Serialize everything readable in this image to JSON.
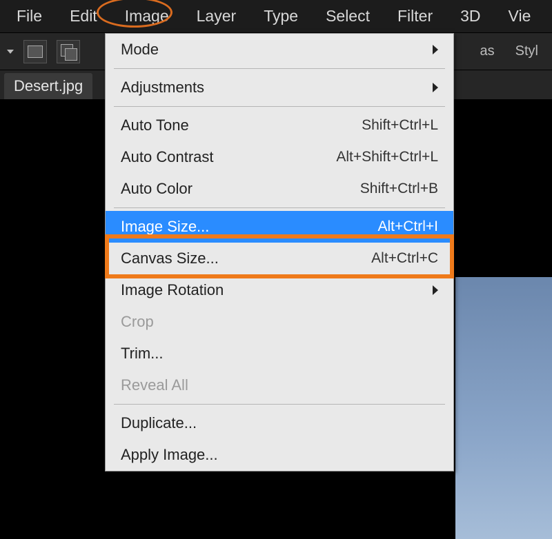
{
  "menubar": {
    "items": [
      "File",
      "Edit",
      "Image",
      "Layer",
      "Type",
      "Select",
      "Filter",
      "3D",
      "Vie"
    ],
    "active_index": 2
  },
  "toolbar": {
    "right_hints": [
      "as",
      "Styl"
    ]
  },
  "document": {
    "tab_label": "Desert.jpg"
  },
  "dropdown": {
    "groups": [
      [
        {
          "label": "Mode",
          "submenu": true
        }
      ],
      [
        {
          "label": "Adjustments",
          "submenu": true
        }
      ],
      [
        {
          "label": "Auto Tone",
          "shortcut": "Shift+Ctrl+L"
        },
        {
          "label": "Auto Contrast",
          "shortcut": "Alt+Shift+Ctrl+L"
        },
        {
          "label": "Auto Color",
          "shortcut": "Shift+Ctrl+B"
        }
      ],
      [
        {
          "label": "Image Size...",
          "shortcut": "Alt+Ctrl+I",
          "highlight": true
        },
        {
          "label": "Canvas Size...",
          "shortcut": "Alt+Ctrl+C"
        },
        {
          "label": "Image Rotation",
          "submenu": true
        },
        {
          "label": "Crop",
          "disabled": true
        },
        {
          "label": "Trim..."
        },
        {
          "label": "Reveal All",
          "disabled": true
        }
      ],
      [
        {
          "label": "Duplicate..."
        },
        {
          "label": "Apply Image..."
        }
      ]
    ]
  }
}
